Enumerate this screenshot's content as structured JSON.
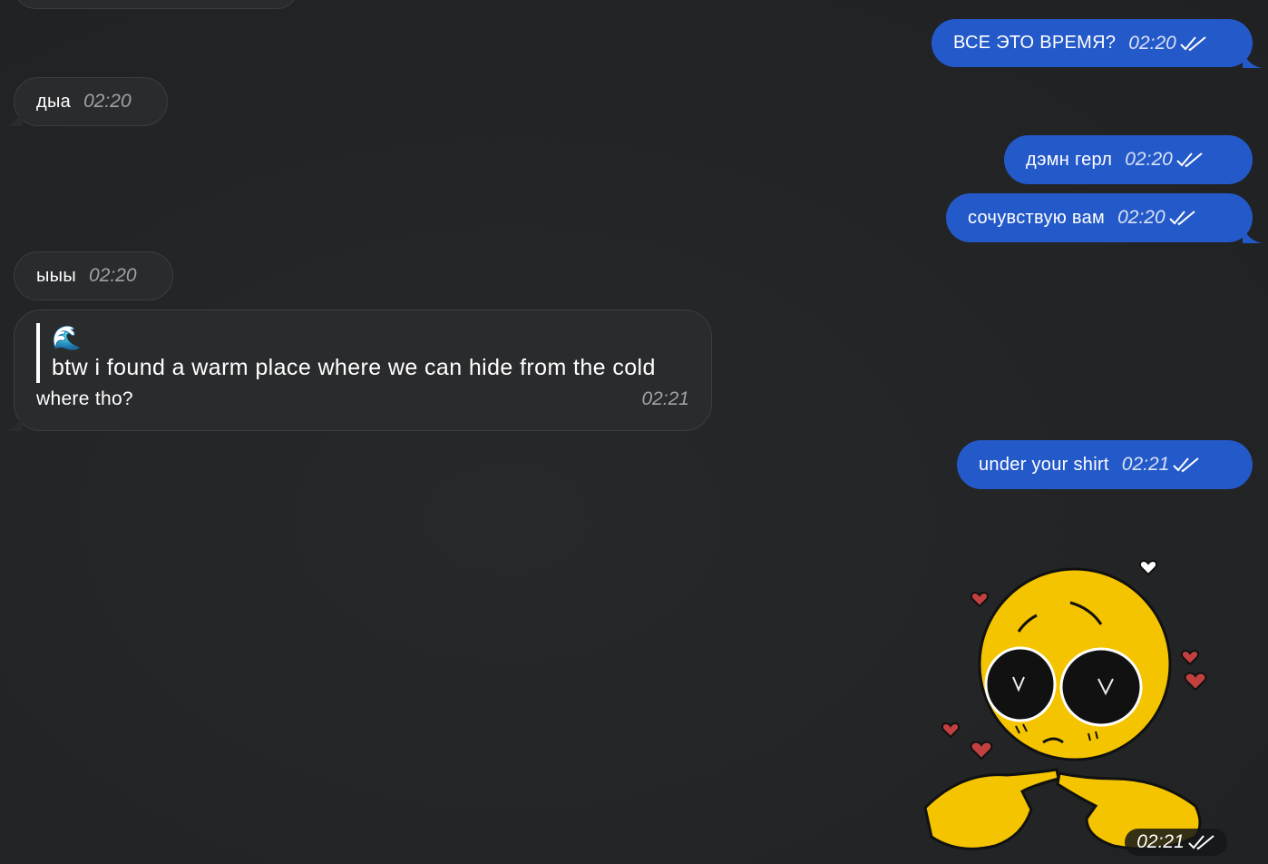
{
  "messages": {
    "top_partial": {
      "side": "in"
    },
    "m1": {
      "side": "out",
      "text": "ВСЕ ЭТО ВРЕМЯ?",
      "time": "02:20",
      "status_icon": "double-check-icon"
    },
    "m2": {
      "side": "in",
      "text": "дыа",
      "time": "02:20"
    },
    "m3": {
      "side": "out",
      "text": "дэмн герл",
      "time": "02:20",
      "status_icon": "double-check-icon"
    },
    "m4": {
      "side": "out",
      "text": "сочувствую вам",
      "time": "02:20",
      "status_icon": "double-check-icon"
    },
    "m5": {
      "side": "in",
      "text": "ыыы",
      "time": "02:20"
    },
    "m6": {
      "side": "in",
      "reply": {
        "emoji": "🌊",
        "quoted_text": "btw i found a warm place where we can hide from the cold"
      },
      "text": "where tho?",
      "time": "02:21"
    },
    "m7": {
      "side": "out",
      "text": "under your shirt",
      "time": "02:21",
      "status_icon": "double-check-icon"
    },
    "m8": {
      "side": "out",
      "type": "sticker",
      "sticker": "shy-emoji-sticker",
      "time": "02:21",
      "status_icon": "double-check-icon"
    }
  },
  "colors": {
    "background": "#222426",
    "incoming_bubble": "#2a2b2d",
    "outgoing_bubble": "#2459c9",
    "sticker_yellow": "#f5c400",
    "heart_red": "#c2403f"
  }
}
